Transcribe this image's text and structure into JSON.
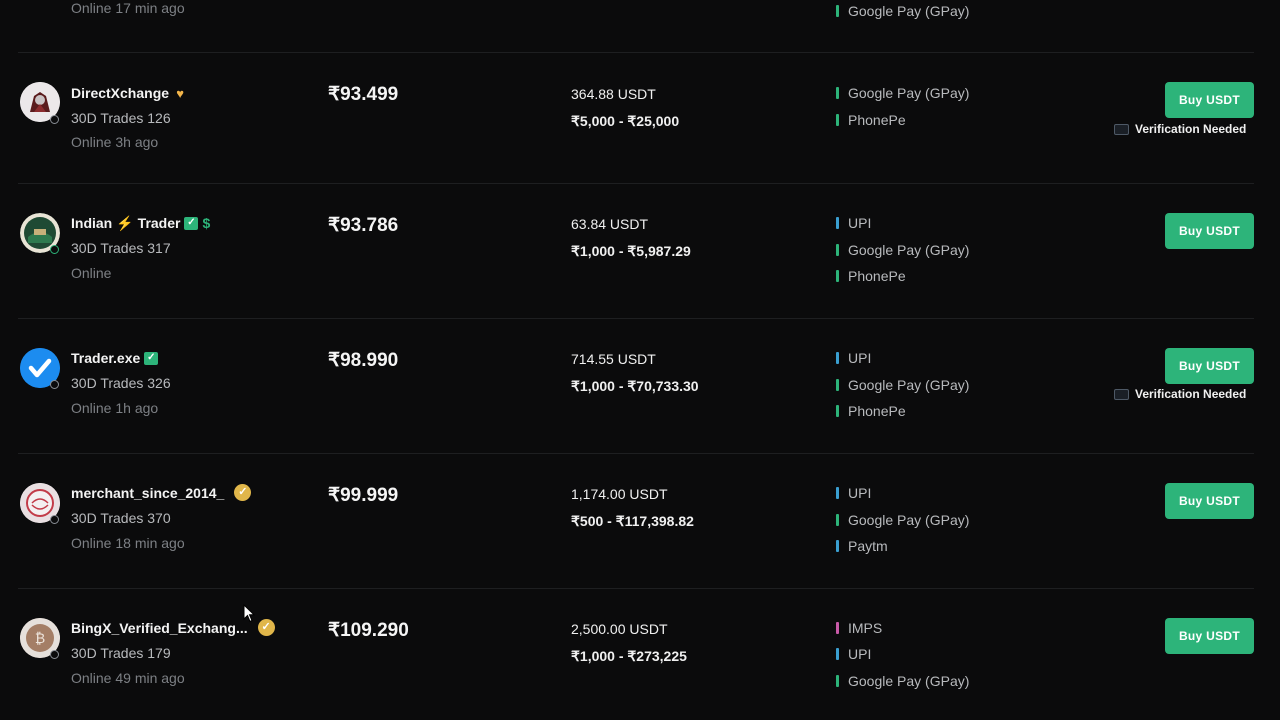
{
  "colors": {
    "background": "#0b0b0c",
    "buy_button": "#2db47a",
    "payment_bars": {
      "UPI": "#3a9fd1",
      "Google Pay (GPay)": "#2db47a",
      "PhonePe": "#2db47a",
      "Paytm": "#3a9fd1",
      "IMPS": "#c95aa8"
    }
  },
  "top_partial": {
    "online": "Online 17 min ago",
    "payment": "Google Pay (GPay)"
  },
  "offers": [
    {
      "name": "DirectXchange",
      "badges": [
        "heart-icon"
      ],
      "trades": "30D Trades 126",
      "online": "Online 3h ago",
      "price": "₹93.499",
      "available": "364.88 USDT",
      "limit": "₹5,000 - ₹25,000",
      "payments": [
        "Google Pay (GPay)",
        "PhonePe"
      ],
      "button": "Buy USDT",
      "verification": "Verification Needed"
    },
    {
      "name_part1": "Indian",
      "name_part2": "Trader",
      "badges": [
        "bolt-icon",
        "verified-check-icon",
        "dollar-icon"
      ],
      "trades": "30D Trades 317",
      "online": "Online",
      "price": "₹93.786",
      "available": "63.84 USDT",
      "limit": "₹1,000 - ₹5,987.29",
      "payments": [
        "UPI",
        "Google Pay (GPay)",
        "PhonePe"
      ],
      "button": "Buy USDT",
      "verification": ""
    },
    {
      "name": "Trader.exe",
      "badges": [
        "verified-check-icon"
      ],
      "trades": "30D Trades 326",
      "online": "Online 1h ago",
      "price": "₹98.990",
      "available": "714.55 USDT",
      "limit": "₹1,000 - ₹70,733.30",
      "payments": [
        "UPI",
        "Google Pay (GPay)",
        "PhonePe"
      ],
      "button": "Buy USDT",
      "verification": "Verification Needed"
    },
    {
      "name": "merchant_since_2014_",
      "badges": [
        "gold-check-icon"
      ],
      "trades": "30D Trades 370",
      "online": "Online 18 min ago",
      "price": "₹99.999",
      "available": "1,174.00 USDT",
      "limit": "₹500 - ₹117,398.82",
      "payments": [
        "UPI",
        "Google Pay (GPay)",
        "Paytm"
      ],
      "button": "Buy USDT",
      "verification": ""
    },
    {
      "name": "BingX_Verified_Exchang...",
      "badges": [
        "gold-check-icon"
      ],
      "trades": "30D Trades 179",
      "online": "Online 49 min ago",
      "price": "₹109.290",
      "available": "2,500.00 USDT",
      "limit": "₹1,000 - ₹273,225",
      "payments": [
        "IMPS",
        "UPI",
        "Google Pay (GPay)"
      ],
      "button": "Buy USDT",
      "verification": ""
    }
  ]
}
